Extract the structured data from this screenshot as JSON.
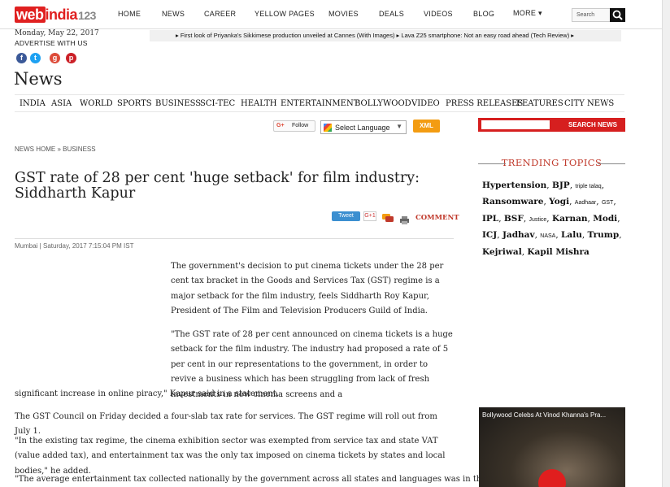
{
  "header": {
    "logo": {
      "web": "web",
      "india": "india",
      "num": "123"
    },
    "nav": [
      "HOME",
      "NEWS",
      "CAREER",
      "YELLOW PAGES",
      "MOVIES",
      "DEALS",
      "VIDEOS",
      "BLOG",
      "MORE ▾"
    ],
    "search_placeholder": "Search",
    "date": "Monday, May 22, 2017",
    "advertise": "ADVERTISE WITH US",
    "ticker": "▸  First look of Priyanka's Sikkimese production unveiled at Cannes (With Images)  ▸  Lava Z25 smartphone: Not an easy road ahead (Tech Review)  ▸"
  },
  "social": [
    {
      "icon": "facebook-icon",
      "glyph": "f",
      "color": "#3b5998"
    },
    {
      "icon": "twitter-icon",
      "glyph": "t",
      "color": "#1da1f2"
    },
    {
      "icon": "googleplus-icon",
      "glyph": "g",
      "color": "#dd4b39"
    },
    {
      "icon": "pinterest-icon",
      "glyph": "p",
      "color": "#cb2027"
    }
  ],
  "section_title": "News",
  "categories": [
    "INDIA",
    "ASIA",
    "WORLD",
    "SPORTS",
    "BUSINESS",
    "SCI-TEC",
    "HEALTH",
    "ENTERTAINMENT",
    "BOLLYWOOD",
    "VIDEO",
    "PRESS RELEASES",
    "FEATURES",
    "CITY NEWS"
  ],
  "toolbar": {
    "follow": "Follow",
    "language": "Select Language",
    "xml": "XML",
    "search_news": "SEARCH NEWS"
  },
  "breadcrumb": "NEWS HOME » BUSINESS",
  "article": {
    "headline": "GST rate of 28 per cent 'huge setback' for film industry: Siddharth Kapur",
    "share": {
      "tweet": "Tweet",
      "gplus": "G+1",
      "comment": "COMMENT"
    },
    "dateline": "Mumbai | Saturday, 2017 7:15:04 PM IST",
    "paragraphs": [
      "The government's decision to put cinema tickets under the 28 per cent tax bracket in the Goods and Services Tax (GST) regime is a major setback for the film industry, feels Siddharth Roy Kapur, President of The Film and Television Producers Guild of India.",
      "\"The GST rate of 28 per cent announced on cinema tickets is a huge setback for the film industry. The industry had proposed a rate of 5 per cent in our representations to the government, in order to revive a business which has been struggling from lack of fresh investments in new cinema screens and a",
      "significant increase in online piracy,\" Kapur said in a statement.",
      "The GST Council on Friday decided a four-slab tax rate for services. The GST regime will roll out from July 1.",
      "\"In the existing tax regime, the cinema exhibition sector was exempted from service tax and state VAT (value added tax), and entertainment tax was the only tax imposed on cinema tickets by states and local bodies,\" he added.",
      "\"The average entertainment tax collected nationally by the government across all states and languages was in the range"
    ]
  },
  "trending": {
    "title": "TRENDING TOPICS",
    "items": [
      {
        "t": "Hypertension",
        "b": true
      },
      {
        "t": "BJP",
        "b": true
      },
      {
        "t": "triple talaq",
        "b": false
      },
      {
        "t": "Ransomware",
        "b": true
      },
      {
        "t": "Yogi",
        "b": true
      },
      {
        "t": "Aadhaar",
        "b": false
      },
      {
        "t": "GST",
        "b": false
      },
      {
        "t": "IPL",
        "b": true
      },
      {
        "t": "BSF",
        "b": true
      },
      {
        "t": "Justice",
        "b": false
      },
      {
        "t": "Karnan",
        "b": true
      },
      {
        "t": "Modi",
        "b": true
      },
      {
        "t": "ICJ",
        "b": true
      },
      {
        "t": "Jadhav",
        "b": true
      },
      {
        "t": "NASA",
        "b": false
      },
      {
        "t": "Lalu",
        "b": true
      },
      {
        "t": "Trump",
        "b": true
      },
      {
        "t": "Kejriwal",
        "b": true
      },
      {
        "t": "Kapil Mishra",
        "b": true
      }
    ]
  },
  "video": {
    "title": "Bollywood Celebs At Vinod Khanna's Pra..."
  }
}
